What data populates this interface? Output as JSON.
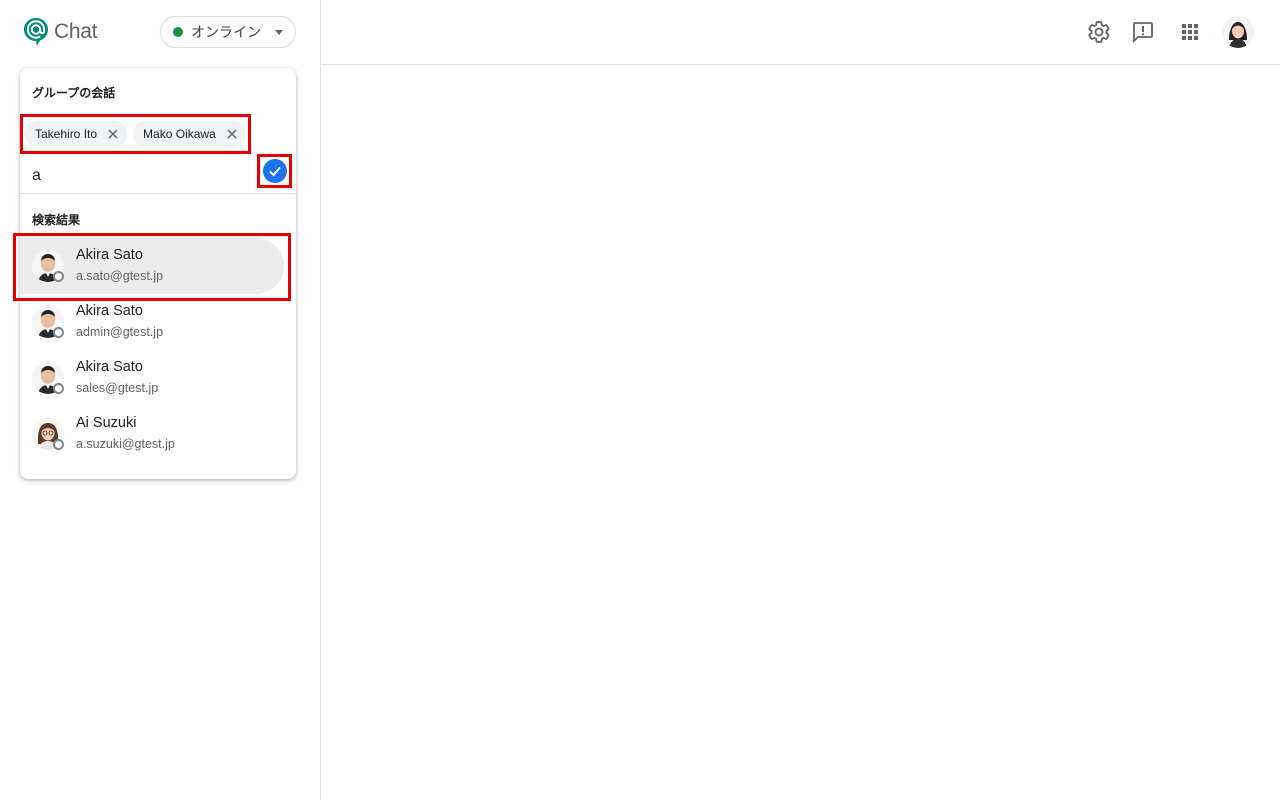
{
  "app": {
    "logo_text": "Chat"
  },
  "status": {
    "label": "オンライン",
    "color": "#1e8e3e"
  },
  "topbar": {
    "icons": [
      "settings-icon",
      "feedback-icon",
      "apps-grid-icon"
    ],
    "account": "account-avatar"
  },
  "dialog": {
    "title": "グループの会話",
    "chips": [
      {
        "label": "Takehiro Ito"
      },
      {
        "label": "Mako Oikawa"
      }
    ],
    "search": {
      "value": "a",
      "placeholder": ""
    },
    "results_label": "検索結果",
    "results": [
      {
        "name": "Akira Sato",
        "email": "a.sato@gtest.jp",
        "highlighted": true
      },
      {
        "name": "Akira Sato",
        "email": "admin@gtest.jp",
        "highlighted": false
      },
      {
        "name": "Akira Sato",
        "email": "sales@gtest.jp",
        "highlighted": false
      },
      {
        "name": "Ai Suzuki",
        "email": "a.suzuki@gtest.jp",
        "highlighted": false
      }
    ]
  },
  "colors": {
    "accent": "#1a73e8",
    "annotation": "#e60000",
    "brand": "#00897b"
  }
}
